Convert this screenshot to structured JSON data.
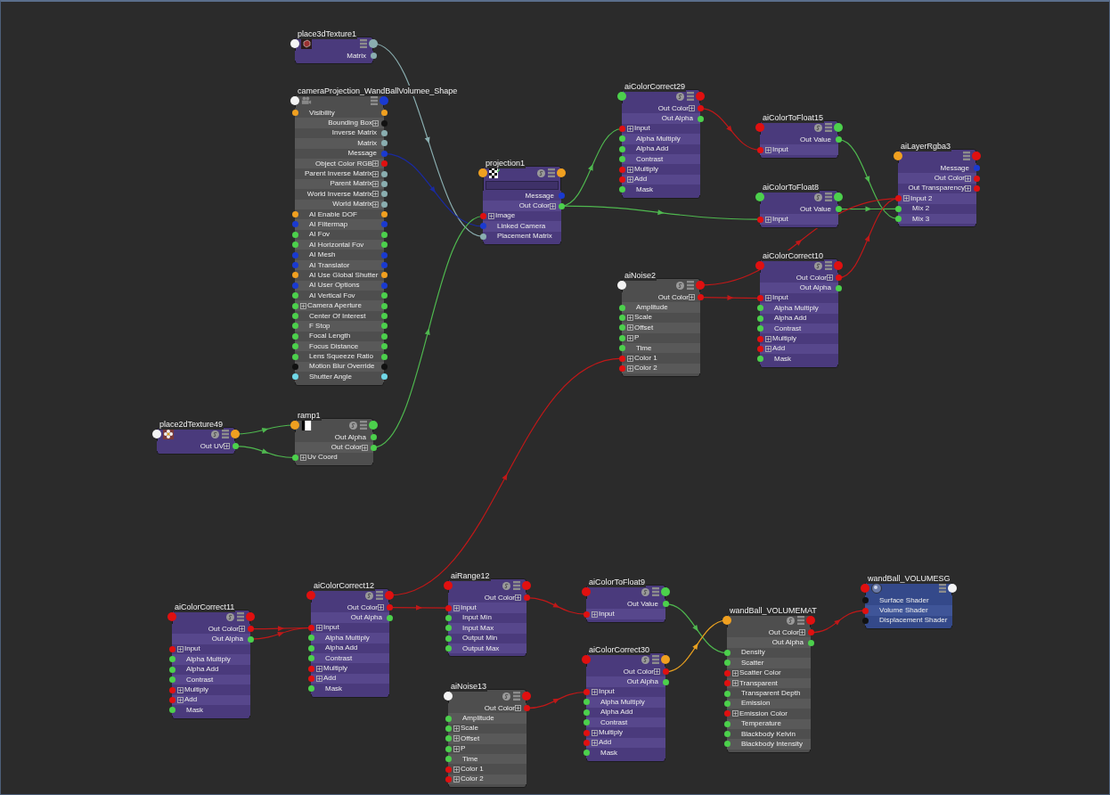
{
  "nodes": [
    {
      "title": "place3dTexture1",
      "kind": "texture",
      "swatch": false,
      "input": {
        "color": "#f4f4f4"
      },
      "output": {
        "color": "#8aaeb0"
      },
      "attributes": [
        {
          "label": "Matrix",
          "kind": "out",
          "color": "#8aaeb0",
          "expandable": false
        }
      ]
    },
    {
      "title": "cameraProjection_WandBallVolumee_Shape",
      "kind": "utility",
      "swatch": false,
      "input": {
        "color": "#f4f4f4"
      },
      "output": {
        "color": "#1a3ad0"
      },
      "attributes": [
        {
          "label": "Visibility",
          "kind": "both",
          "color": "#f0a020",
          "expandable": false
        },
        {
          "label": "Bounding Box",
          "kind": "out",
          "color": "#111111",
          "expandable": true
        },
        {
          "label": "Inverse Matrix",
          "kind": "out",
          "color": "#8aaeb0",
          "expandable": false
        },
        {
          "label": "Matrix",
          "kind": "out",
          "color": "#8aaeb0",
          "expandable": false
        },
        {
          "label": "Message",
          "kind": "out",
          "color": "#1a3ad0",
          "expandable": false
        },
        {
          "label": "Object Color RGB",
          "kind": "out",
          "color": "#e01010",
          "expandable": true
        },
        {
          "label": "Parent Inverse Matrix",
          "kind": "out",
          "color": "#8aaeb0",
          "expandable": true
        },
        {
          "label": "Parent Matrix",
          "kind": "out",
          "color": "#8aaeb0",
          "expandable": true
        },
        {
          "label": "World Inverse Matrix",
          "kind": "out",
          "color": "#8aaeb0",
          "expandable": true
        },
        {
          "label": "World Matrix",
          "kind": "out",
          "color": "#8aaeb0",
          "expandable": true
        },
        {
          "label": "AI Enable DOF",
          "kind": "both",
          "color": "#f0a020",
          "expandable": false
        },
        {
          "label": "AI Filtermap",
          "kind": "both",
          "color": "#1a3ad0",
          "expandable": false
        },
        {
          "label": "AI Fov",
          "kind": "both",
          "color": "#4cd04c",
          "expandable": false
        },
        {
          "label": "AI Horizontal Fov",
          "kind": "both",
          "color": "#4cd04c",
          "expandable": false
        },
        {
          "label": "AI Mesh",
          "kind": "both",
          "color": "#1a3ad0",
          "expandable": false
        },
        {
          "label": "AI Translator",
          "kind": "both",
          "color": "#1a3ad0",
          "expandable": false
        },
        {
          "label": "AI Use Global Shutter",
          "kind": "both",
          "color": "#f0a020",
          "expandable": false
        },
        {
          "label": "AI User Options",
          "kind": "both",
          "color": "#1a3ad0",
          "expandable": false
        },
        {
          "label": "AI Vertical Fov",
          "kind": "both",
          "color": "#4cd04c",
          "expandable": false
        },
        {
          "label": "Camera Aperture",
          "kind": "both",
          "color": "#4cd04c",
          "expandable": true
        },
        {
          "label": "Center Of Interest",
          "kind": "both",
          "color": "#4cd04c",
          "expandable": false
        },
        {
          "label": "F Stop",
          "kind": "both",
          "color": "#4cd04c",
          "expandable": false
        },
        {
          "label": "Focal Length",
          "kind": "both",
          "color": "#4cd04c",
          "expandable": false
        },
        {
          "label": "Focus Distance",
          "kind": "both",
          "color": "#4cd04c",
          "expandable": false
        },
        {
          "label": "Lens Squeeze Ratio",
          "kind": "both",
          "color": "#4cd04c",
          "expandable": false
        },
        {
          "label": "Motion Blur Override",
          "kind": "both",
          "color": "#111111",
          "expandable": false
        },
        {
          "label": "Shutter Angle",
          "kind": "both",
          "color": "#70d8e8",
          "expandable": false
        }
      ]
    },
    {
      "title": "place2dTexture49",
      "kind": "texture",
      "swatch": true,
      "input": {
        "color": "#f4f4f4"
      },
      "output": {
        "color": "#f0a020"
      },
      "attributes": [
        {
          "label": "Out UV",
          "kind": "out",
          "color": "#4cd04c",
          "expandable": true
        }
      ]
    },
    {
      "title": "ramp1",
      "kind": "utility",
      "swatch": true,
      "input": {
        "color": "#f0a020"
      },
      "output": {
        "color": "#4cd04c"
      },
      "attributes": [
        {
          "label": "Out Alpha",
          "kind": "out",
          "color": "#4cd04c",
          "expandable": false
        },
        {
          "label": "Out Color",
          "kind": "out",
          "color": "#4cd04c",
          "expandable": true
        },
        {
          "label": "Uv Coord",
          "kind": "in",
          "color": "#4cd04c",
          "expandable": true
        }
      ]
    },
    {
      "title": "projection1",
      "kind": "texture",
      "swatch": true,
      "field": true,
      "input": {
        "color": "#f0a020"
      },
      "output": {
        "color": "#f0a020"
      },
      "attributes": [
        {
          "label": "Message",
          "kind": "out",
          "color": "#1a3ad0",
          "expandable": false
        },
        {
          "label": "Out Color",
          "kind": "out",
          "color": "#4cd04c",
          "expandable": true
        },
        {
          "label": "Image",
          "kind": "in",
          "color": "#e01010",
          "expandable": true
        },
        {
          "label": "Linked Camera",
          "kind": "in",
          "color": "#1a3ad0",
          "expandable": false
        },
        {
          "label": "Placement Matrix",
          "kind": "in",
          "color": "#8aaeb0",
          "expandable": false
        }
      ]
    },
    {
      "title": "aiColorCorrect29",
      "kind": "texture",
      "swatch": true,
      "input": {
        "color": "#4cd04c"
      },
      "output": {
        "color": "#e01010"
      },
      "attributes": [
        {
          "label": "Out Color",
          "kind": "out",
          "color": "#e01010",
          "expandable": true
        },
        {
          "label": "Out Alpha",
          "kind": "out",
          "color": "#4cd04c",
          "expandable": false
        },
        {
          "label": "Input",
          "kind": "in",
          "color": "#e01010",
          "expandable": true
        },
        {
          "label": "Alpha Multiply",
          "kind": "in",
          "color": "#4cd04c",
          "expandable": false
        },
        {
          "label": "Alpha Add",
          "kind": "in",
          "color": "#4cd04c",
          "expandable": false
        },
        {
          "label": "Contrast",
          "kind": "in",
          "color": "#4cd04c",
          "expandable": false
        },
        {
          "label": "Multiply",
          "kind": "in",
          "color": "#e01010",
          "expandable": true
        },
        {
          "label": "Add",
          "kind": "in",
          "color": "#e01010",
          "expandable": true
        },
        {
          "label": "Mask",
          "kind": "in",
          "color": "#4cd04c",
          "expandable": false
        }
      ]
    },
    {
      "title": "aiColorToFloat15",
      "kind": "texture",
      "swatch": true,
      "input": {
        "color": "#e01010"
      },
      "output": {
        "color": "#4cd04c"
      },
      "attributes": [
        {
          "label": "Out Value",
          "kind": "out",
          "color": "#4cd04c",
          "expandable": false
        },
        {
          "label": "Input",
          "kind": "in",
          "color": "#e01010",
          "expandable": true
        }
      ]
    },
    {
      "title": "aiColorToFloat8",
      "kind": "texture",
      "swatch": true,
      "input": {
        "color": "#4cd04c"
      },
      "output": {
        "color": "#4cd04c"
      },
      "attributes": [
        {
          "label": "Out Value",
          "kind": "out",
          "color": "#4cd04c",
          "expandable": false
        },
        {
          "label": "Input",
          "kind": "in",
          "color": "#e01010",
          "expandable": true
        }
      ]
    },
    {
      "title": "aiLayerRgba3",
      "kind": "texture",
      "swatch": false,
      "input": {
        "color": "#f0a020"
      },
      "output": {
        "color": "#e01010"
      },
      "attributes": [
        {
          "label": "Message",
          "kind": "out",
          "color": "#1a3ad0",
          "expandable": false
        },
        {
          "label": "Out Color",
          "kind": "out",
          "color": "#e01010",
          "expandable": true
        },
        {
          "label": "Out Transparency",
          "kind": "out",
          "color": "#e01010",
          "expandable": true
        },
        {
          "label": "Input 2",
          "kind": "in",
          "color": "#e01010",
          "expandable": true
        },
        {
          "label": "Mix 2",
          "kind": "in",
          "color": "#4cd04c",
          "expandable": false
        },
        {
          "label": "Mix 3",
          "kind": "in",
          "color": "#4cd04c",
          "expandable": false
        }
      ]
    },
    {
      "title": "aiNoise2",
      "kind": "utility",
      "swatch": true,
      "input": {
        "color": "#f4f4f4"
      },
      "output": {
        "color": "#e01010"
      },
      "attributes": [
        {
          "label": "Out Color",
          "kind": "out",
          "color": "#e01010",
          "expandable": true
        },
        {
          "label": "Amplitude",
          "kind": "in",
          "color": "#4cd04c",
          "expandable": false
        },
        {
          "label": "Scale",
          "kind": "in",
          "color": "#4cd04c",
          "expandable": true
        },
        {
          "label": "Offset",
          "kind": "in",
          "color": "#4cd04c",
          "expandable": true
        },
        {
          "label": "P",
          "kind": "in",
          "color": "#4cd04c",
          "expandable": true
        },
        {
          "label": "Time",
          "kind": "in",
          "color": "#4cd04c",
          "expandable": false
        },
        {
          "label": "Color 1",
          "kind": "in",
          "color": "#e01010",
          "expandable": true
        },
        {
          "label": "Color 2",
          "kind": "in",
          "color": "#e01010",
          "expandable": true
        }
      ]
    },
    {
      "title": "aiColorCorrect10",
      "kind": "texture",
      "swatch": true,
      "input": {
        "color": "#e01010"
      },
      "output": {
        "color": "#e01010"
      },
      "attributes": [
        {
          "label": "Out Color",
          "kind": "out",
          "color": "#e01010",
          "expandable": true
        },
        {
          "label": "Out Alpha",
          "kind": "out",
          "color": "#4cd04c",
          "expandable": false
        },
        {
          "label": "Input",
          "kind": "in",
          "color": "#e01010",
          "expandable": true
        },
        {
          "label": "Alpha Multiply",
          "kind": "in",
          "color": "#4cd04c",
          "expandable": false
        },
        {
          "label": "Alpha Add",
          "kind": "in",
          "color": "#4cd04c",
          "expandable": false
        },
        {
          "label": "Contrast",
          "kind": "in",
          "color": "#4cd04c",
          "expandable": false
        },
        {
          "label": "Multiply",
          "kind": "in",
          "color": "#e01010",
          "expandable": true
        },
        {
          "label": "Add",
          "kind": "in",
          "color": "#e01010",
          "expandable": true
        },
        {
          "label": "Mask",
          "kind": "in",
          "color": "#4cd04c",
          "expandable": false
        }
      ]
    },
    {
      "title": "aiColorCorrect11",
      "kind": "texture",
      "swatch": true,
      "input": {
        "color": "#e01010"
      },
      "output": {
        "color": "#e01010"
      },
      "attributes": [
        {
          "label": "Out Color",
          "kind": "out",
          "color": "#e01010",
          "expandable": true
        },
        {
          "label": "Out Alpha",
          "kind": "out",
          "color": "#4cd04c",
          "expandable": false
        },
        {
          "label": "Input",
          "kind": "in",
          "color": "#e01010",
          "expandable": true
        },
        {
          "label": "Alpha Multiply",
          "kind": "in",
          "color": "#4cd04c",
          "expandable": false
        },
        {
          "label": "Alpha Add",
          "kind": "in",
          "color": "#4cd04c",
          "expandable": false
        },
        {
          "label": "Contrast",
          "kind": "in",
          "color": "#4cd04c",
          "expandable": false
        },
        {
          "label": "Multiply",
          "kind": "in",
          "color": "#e01010",
          "expandable": true
        },
        {
          "label": "Add",
          "kind": "in",
          "color": "#e01010",
          "expandable": true
        },
        {
          "label": "Mask",
          "kind": "in",
          "color": "#4cd04c",
          "expandable": false
        }
      ]
    },
    {
      "title": "aiColorCorrect12",
      "kind": "texture",
      "swatch": true,
      "input": {
        "color": "#e01010"
      },
      "output": {
        "color": "#e01010"
      },
      "attributes": [
        {
          "label": "Out Color",
          "kind": "out",
          "color": "#e01010",
          "expandable": true
        },
        {
          "label": "Out Alpha",
          "kind": "out",
          "color": "#4cd04c",
          "expandable": false
        },
        {
          "label": "Input",
          "kind": "in",
          "color": "#e01010",
          "expandable": true
        },
        {
          "label": "Alpha Multiply",
          "kind": "in",
          "color": "#4cd04c",
          "expandable": false
        },
        {
          "label": "Alpha Add",
          "kind": "in",
          "color": "#4cd04c",
          "expandable": false
        },
        {
          "label": "Contrast",
          "kind": "in",
          "color": "#4cd04c",
          "expandable": false
        },
        {
          "label": "Multiply",
          "kind": "in",
          "color": "#e01010",
          "expandable": true
        },
        {
          "label": "Add",
          "kind": "in",
          "color": "#e01010",
          "expandable": true
        },
        {
          "label": "Mask",
          "kind": "in",
          "color": "#4cd04c",
          "expandable": false
        }
      ]
    },
    {
      "title": "aiRange12",
      "kind": "texture",
      "swatch": true,
      "input": {
        "color": "#e01010"
      },
      "output": {
        "color": "#e01010"
      },
      "attributes": [
        {
          "label": "Out Color",
          "kind": "out",
          "color": "#e01010",
          "expandable": true
        },
        {
          "label": "Input",
          "kind": "in",
          "color": "#e01010",
          "expandable": true
        },
        {
          "label": "Input Min",
          "kind": "in",
          "color": "#4cd04c",
          "expandable": false
        },
        {
          "label": "Input Max",
          "kind": "in",
          "color": "#4cd04c",
          "expandable": false
        },
        {
          "label": "Output Min",
          "kind": "in",
          "color": "#4cd04c",
          "expandable": false
        },
        {
          "label": "Output Max",
          "kind": "in",
          "color": "#4cd04c",
          "expandable": false
        }
      ]
    },
    {
      "title": "aiColorToFloat9",
      "kind": "texture",
      "swatch": true,
      "input": {
        "color": "#e01010"
      },
      "output": {
        "color": "#4cd04c"
      },
      "attributes": [
        {
          "label": "Out Value",
          "kind": "out",
          "color": "#4cd04c",
          "expandable": false
        },
        {
          "label": "Input",
          "kind": "in",
          "color": "#e01010",
          "expandable": true
        }
      ]
    },
    {
      "title": "wandBall_VOLUMESG",
      "kind": "shading_group",
      "swatch": false,
      "input": {
        "color": "#e01010"
      },
      "output": {
        "color": "#f4f4f4"
      },
      "attributes": [
        {
          "label": "Surface Shader",
          "kind": "in",
          "color": "#111111",
          "expandable": false
        },
        {
          "label": "Volume Shader",
          "kind": "in",
          "color": "#e01010",
          "expandable": false
        },
        {
          "label": "Displacement Shader",
          "kind": "in",
          "color": "#111111",
          "expandable": false
        }
      ]
    },
    {
      "title": "wandBall_VOLUMEMAT",
      "kind": "utility",
      "swatch": true,
      "input": {
        "color": "#f0a020"
      },
      "output": {
        "color": "#e01010"
      },
      "attributes": [
        {
          "label": "Out Color",
          "kind": "out",
          "color": "#e01010",
          "expandable": true
        },
        {
          "label": "Out Alpha",
          "kind": "out",
          "color": "#4cd04c",
          "expandable": false
        },
        {
          "label": "Density",
          "kind": "in",
          "color": "#4cd04c",
          "expandable": false
        },
        {
          "label": "Scatter",
          "kind": "in",
          "color": "#4cd04c",
          "expandable": false
        },
        {
          "label": "Scatter Color",
          "kind": "in",
          "color": "#e01010",
          "expandable": true
        },
        {
          "label": "Transparent",
          "kind": "in",
          "color": "#e01010",
          "expandable": true
        },
        {
          "label": "Transparent Depth",
          "kind": "in",
          "color": "#4cd04c",
          "expandable": false
        },
        {
          "label": "Emission",
          "kind": "in",
          "color": "#4cd04c",
          "expandable": false
        },
        {
          "label": "Emission Color",
          "kind": "in",
          "color": "#e01010",
          "expandable": true
        },
        {
          "label": "Temperature",
          "kind": "in",
          "color": "#4cd04c",
          "expandable": false
        },
        {
          "label": "Blackbody Kelvin",
          "kind": "in",
          "color": "#4cd04c",
          "expandable": false
        },
        {
          "label": "Blackbody Intensity",
          "kind": "in",
          "color": "#4cd04c",
          "expandable": false
        }
      ]
    },
    {
      "title": "aiColorCorrect30",
      "kind": "texture",
      "swatch": true,
      "input": {
        "color": "#e01010"
      },
      "output": {
        "color": "#f0a020"
      },
      "attributes": [
        {
          "label": "Out Color",
          "kind": "out",
          "color": "#e01010",
          "expandable": true
        },
        {
          "label": "Out Alpha",
          "kind": "out",
          "color": "#4cd04c",
          "expandable": false
        },
        {
          "label": "Input",
          "kind": "in",
          "color": "#e01010",
          "expandable": true
        },
        {
          "label": "Alpha Multiply",
          "kind": "in",
          "color": "#4cd04c",
          "expandable": false
        },
        {
          "label": "Alpha Add",
          "kind": "in",
          "color": "#4cd04c",
          "expandable": false
        },
        {
          "label": "Contrast",
          "kind": "in",
          "color": "#4cd04c",
          "expandable": false
        },
        {
          "label": "Multiply",
          "kind": "in",
          "color": "#e01010",
          "expandable": true
        },
        {
          "label": "Add",
          "kind": "in",
          "color": "#e01010",
          "expandable": true
        },
        {
          "label": "Mask",
          "kind": "in",
          "color": "#4cd04c",
          "expandable": false
        }
      ]
    },
    {
      "title": "aiNoise13",
      "kind": "utility",
      "swatch": true,
      "input": {
        "color": "#f4f4f4"
      },
      "output": {
        "color": "#e01010"
      },
      "attributes": [
        {
          "label": "Out Color",
          "kind": "out",
          "color": "#e01010",
          "expandable": true
        },
        {
          "label": "Amplitude",
          "kind": "in",
          "color": "#4cd04c",
          "expandable": false
        },
        {
          "label": "Scale",
          "kind": "in",
          "color": "#4cd04c",
          "expandable": true
        },
        {
          "label": "Offset",
          "kind": "in",
          "color": "#4cd04c",
          "expandable": true
        },
        {
          "label": "P",
          "kind": "in",
          "color": "#4cd04c",
          "expandable": true
        },
        {
          "label": "Time",
          "kind": "in",
          "color": "#4cd04c",
          "expandable": false
        },
        {
          "label": "Color 1",
          "kind": "in",
          "color": "#e01010",
          "expandable": true
        },
        {
          "label": "Color 2",
          "kind": "in",
          "color": "#e01010",
          "expandable": true
        }
      ]
    }
  ]
}
